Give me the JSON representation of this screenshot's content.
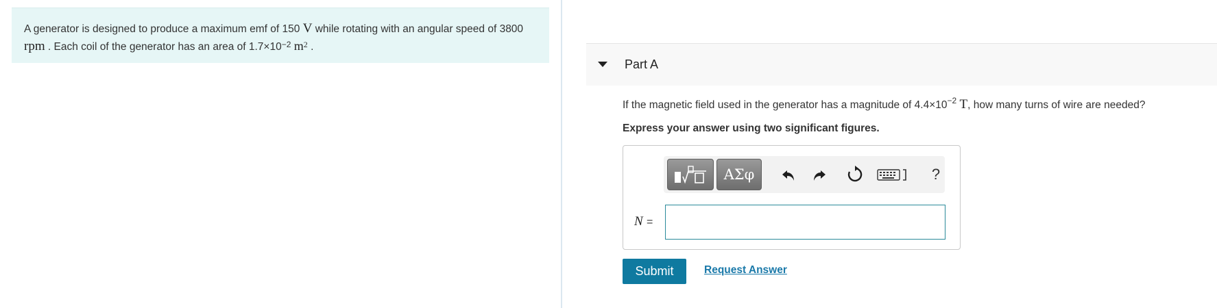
{
  "intro": {
    "text_1": "A generator is designed to produce a maximum emf of 150",
    "unit_emf": "V",
    "text_2": "while rotating with an angular speed of 3800",
    "unit_speed": "rpm",
    "text_3": ". Each coil of the generator has an area of 1.7×10",
    "area_exponent": "−2",
    "unit_area": "m",
    "unit_area_exponent": "2",
    "text_4": "."
  },
  "part": {
    "title": "Part A",
    "question_1": "If the magnetic field used in the generator has a magnitude of 4.4×10",
    "question_exponent": "−2",
    "question_unit": "T",
    "question_2": ", how many turns of wire are needed?",
    "instruction": "Express your answer using two significant figures."
  },
  "toolbar": {
    "symbols_label": "ΑΣφ",
    "help_label": "?",
    "icons": [
      "templates-icon",
      "undo-icon",
      "redo-icon",
      "reset-icon",
      "keyboard-icon",
      "help-icon"
    ]
  },
  "answer": {
    "variable": "N",
    "equals": "=",
    "value": ""
  },
  "actions": {
    "submit_label": "Submit",
    "request_label": "Request Answer"
  },
  "colors": {
    "intro_background": "#e6f6f6",
    "submit_background": "#0f7aa0",
    "link": "#1a79a9",
    "input_border": "#2a8a9a"
  }
}
